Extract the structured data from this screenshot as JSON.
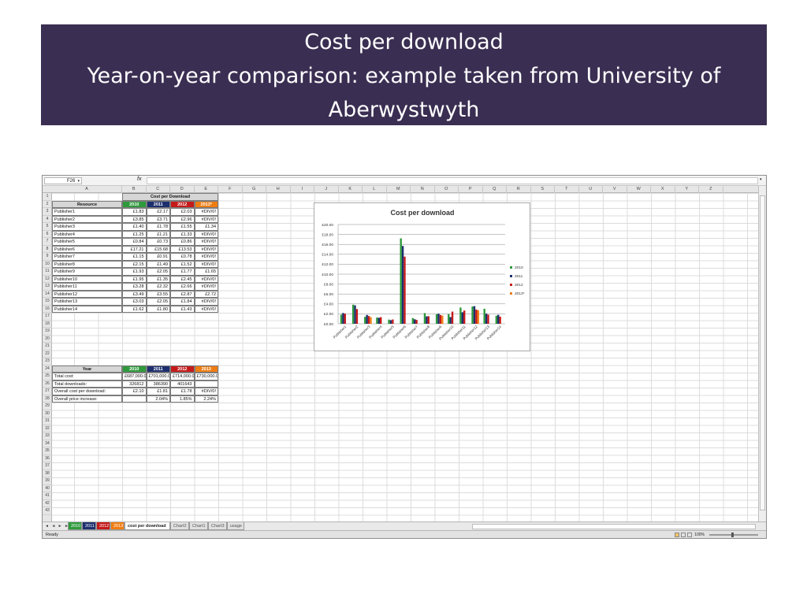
{
  "slide": {
    "title_lines": [
      "Cost per download",
      "Year-on-year comparison: example taken from University of",
      "Aberwystwyth"
    ],
    "title_bg": "#3a2e52"
  },
  "excel": {
    "name_box": "F26",
    "fx_label": "fx",
    "column_headers": [
      "A",
      "B",
      "C",
      "D",
      "E",
      "F",
      "G",
      "H",
      "I",
      "J",
      "K",
      "L",
      "M",
      "N",
      "O",
      "P",
      "Q",
      "R",
      "S",
      "T",
      "U",
      "V",
      "W",
      "X",
      "Y",
      "Z"
    ],
    "row_numbers": [
      "1",
      "2",
      "3",
      "4",
      "5",
      "6",
      "7",
      "8",
      "9",
      "10",
      "11",
      "12",
      "13",
      "14",
      "15",
      "16",
      "17",
      "18",
      "19",
      "20",
      "21",
      "22",
      "23",
      "24",
      "25",
      "26",
      "27",
      "28",
      "29",
      "30",
      "31",
      "32",
      "33",
      "34",
      "35",
      "36",
      "37",
      "38",
      "39",
      "40",
      "41",
      "42",
      "43"
    ],
    "table1": {
      "group_header": "Cost per Download",
      "resource_header": "Resource",
      "year_headers": [
        "2010",
        "2011",
        "2012",
        "2013*"
      ],
      "rows": [
        {
          "name": "Publisher1",
          "v": [
            "£1.83",
            "£2.17",
            "£2.03",
            "#DIV/0!"
          ]
        },
        {
          "name": "Publisher2",
          "v": [
            "£3.85",
            "£3.71",
            "£2.96",
            "#DIV/0!"
          ]
        },
        {
          "name": "Publisher3",
          "v": [
            "£1.40",
            "£1.78",
            "£1.55",
            "£1.34"
          ]
        },
        {
          "name": "Publisher4",
          "v": [
            "£1.25",
            "£1.21",
            "£1.33",
            "#DIV/0!"
          ]
        },
        {
          "name": "Publisher5",
          "v": [
            "£0.84",
            "£0.73",
            "£0.86",
            "#DIV/0!"
          ]
        },
        {
          "name": "Publisher6",
          "v": [
            "£17.21",
            "£15.68",
            "£13.53",
            "#DIV/0!"
          ]
        },
        {
          "name": "Publisher7",
          "v": [
            "£1.15",
            "£0.91",
            "£0.78",
            "#DIV/0!"
          ]
        },
        {
          "name": "Publisher8",
          "v": [
            "£2.15",
            "£1.49",
            "£1.52",
            "#DIV/0!"
          ]
        },
        {
          "name": "Publisher9",
          "v": [
            "£1.93",
            "£2.05",
            "£1.77",
            "£1.65"
          ]
        },
        {
          "name": "Publisher10",
          "v": [
            "£1.95",
            "£1.35",
            "£2.45",
            "#DIV/0!"
          ]
        },
        {
          "name": "Publisher11",
          "v": [
            "£3.28",
            "£2.32",
            "£2.66",
            "#DIV/0!"
          ]
        },
        {
          "name": "Publisher12",
          "v": [
            "£3.49",
            "£3.55",
            "£2.87",
            "£2.72"
          ]
        },
        {
          "name": "Publisher13",
          "v": [
            "£3.03",
            "£2.05",
            "£1.84",
            "#DIV/0!"
          ]
        },
        {
          "name": "Publisher14",
          "v": [
            "£1.62",
            "£1.80",
            "£1.43",
            "#DIV/0!"
          ]
        }
      ]
    },
    "table2": {
      "year_label": "Year",
      "year_headers": [
        "2010",
        "2011",
        "2012",
        "2013"
      ],
      "rows": [
        {
          "label": "Total cost:",
          "v": [
            "£687,000.00",
            "£701,000.00",
            "£714,000.00",
            "£730,000.00"
          ]
        },
        {
          "label": "Total downloads:",
          "v": [
            "326812",
            "386390",
            "401643",
            ""
          ]
        },
        {
          "label": "Overall cost per download:",
          "v": [
            "£2.10",
            "£1.81",
            "£1.78",
            "#DIV/0!"
          ]
        },
        {
          "label": "Overall price increase:",
          "v": [
            "",
            "2.04%",
            "1.85%",
            "2.24%"
          ]
        }
      ]
    },
    "sheet_tabs": [
      "2010",
      "2011",
      "2012",
      "2013",
      "cost per download",
      "Chart2",
      "Chart1",
      "Chart3",
      "usage"
    ],
    "sheet_tab_colors": [
      "#2e9a3c",
      "#1d2f6e",
      "#c51a1a",
      "#ef7d12"
    ],
    "status": "Ready",
    "zoom": "100%"
  },
  "chart_data": {
    "type": "bar",
    "title": "Cost per download",
    "categories": [
      "Publisher1",
      "Publisher2",
      "Publisher3",
      "Publisher4",
      "Publisher5",
      "Publisher6",
      "Publisher7",
      "Publisher8",
      "Publisher9",
      "Publisher10",
      "Publisher11",
      "Publisher12",
      "Publisher13",
      "Publisher14"
    ],
    "series": [
      {
        "name": "2010",
        "color": "#2e9a3c",
        "values": [
          1.83,
          3.85,
          1.4,
          1.25,
          0.84,
          17.21,
          1.15,
          2.15,
          1.93,
          1.95,
          3.28,
          3.49,
          3.03,
          1.62
        ]
      },
      {
        "name": "2011",
        "color": "#1d2f6e",
        "values": [
          2.17,
          3.71,
          1.78,
          1.21,
          0.73,
          15.68,
          0.91,
          1.49,
          2.05,
          1.35,
          2.32,
          3.55,
          2.05,
          1.8
        ]
      },
      {
        "name": "2012",
        "color": "#c51a1a",
        "values": [
          2.03,
          2.96,
          1.55,
          1.33,
          0.86,
          13.53,
          0.78,
          1.52,
          1.77,
          2.45,
          2.66,
          2.87,
          1.84,
          1.43
        ]
      },
      {
        "name": "2013*",
        "color": "#ef7d12",
        "values": [
          0,
          0,
          1.34,
          0,
          0,
          0,
          0,
          0,
          1.65,
          0,
          0,
          2.72,
          0,
          0
        ]
      }
    ],
    "y_ticks": [
      "£0.00",
      "£2.00",
      "£4.00",
      "£6.00",
      "£8.00",
      "£10.00",
      "£12.00",
      "£14.00",
      "£16.00",
      "£18.00",
      "£20.00"
    ],
    "ylim": [
      0,
      20
    ],
    "grid": true,
    "legend": "right"
  }
}
